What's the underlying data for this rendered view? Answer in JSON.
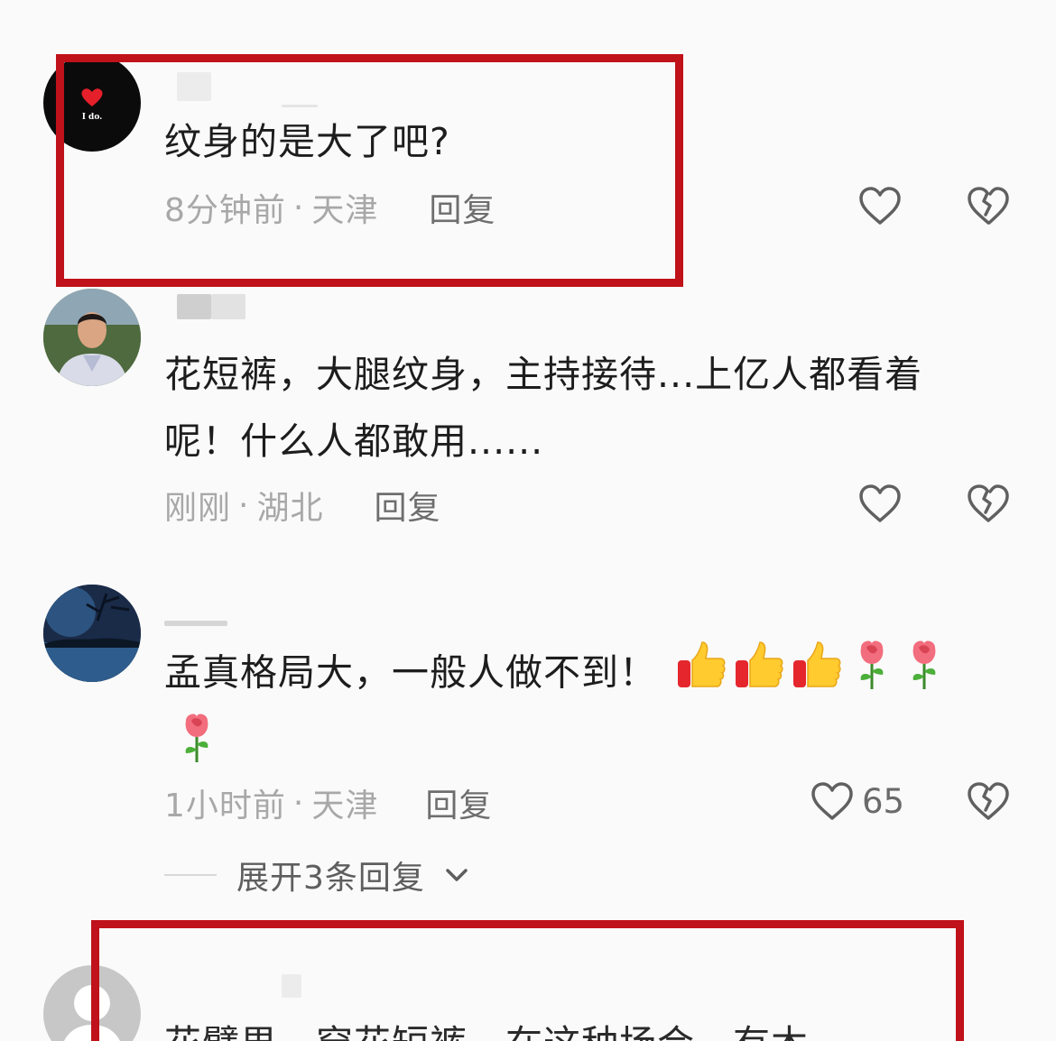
{
  "comments": [
    {
      "text": "纹身的是大了吧?",
      "time": "8分钟前",
      "location": "天津",
      "reply_label": "回复"
    },
    {
      "text_line1": "花短裤，大腿纹身，主持接待...上亿人都看着",
      "text_line2": "呢！什么人都敢用......",
      "time": "刚刚",
      "location": "湖北",
      "reply_label": "回复"
    },
    {
      "text": "孟真格局大，一般人做不到！",
      "emojis": [
        "thumbs-up",
        "thumbs-up",
        "thumbs-up",
        "rose",
        "rose",
        "rose"
      ],
      "time": "1小时前",
      "location": "天津",
      "reply_label": "回复",
      "like_count": "65",
      "expand_label": "展开3条回复"
    },
    {
      "text": "花臂男，穿花短裤，在这种场合，有木..."
    }
  ],
  "separator": "·",
  "avatar1_text": "I do.",
  "colors": {
    "highlight_box": "#c0121a",
    "text": "#1d1d1d",
    "meta": "#a8a8a8"
  }
}
